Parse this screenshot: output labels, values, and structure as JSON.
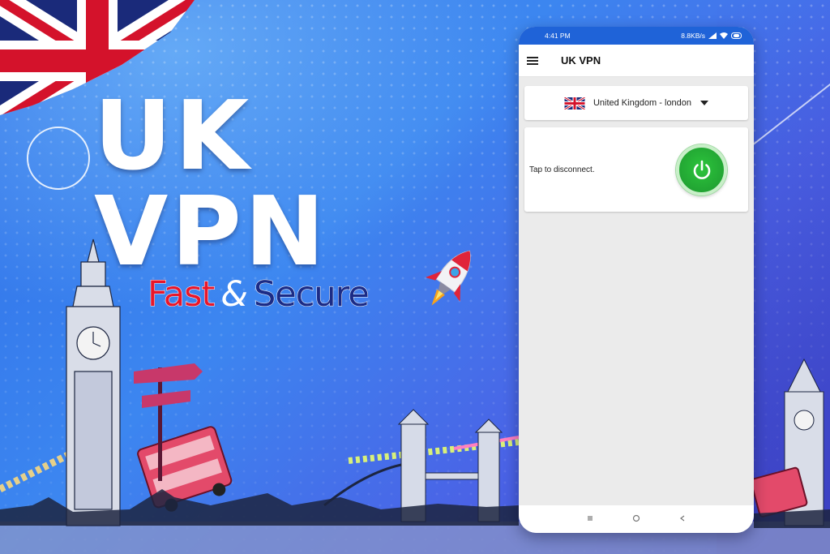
{
  "banner": {
    "headline": "UK VPN",
    "tagline_fast": "Fast",
    "tagline_amp": "&",
    "tagline_secure": "Secure"
  },
  "phone": {
    "status_bar": {
      "time": "4:41 PM",
      "speed": "8.8KB/s"
    },
    "app_bar": {
      "title": "UK VPN",
      "menu_icon": "hamburger-menu-icon"
    },
    "server": {
      "label": "United Kingdom - london",
      "flag_icon": "uk-flag-icon"
    },
    "connection": {
      "status_text": "Tap to disconnect.",
      "power_icon": "power-icon"
    },
    "nav": {
      "recents_icon": "recents-icon",
      "home_icon": "home-icon",
      "back_icon": "back-icon"
    }
  },
  "colors": {
    "background": "#3c86f0",
    "status_bar": "#1f63d8",
    "power_button": "#22a533",
    "tagline_red": "#e8162a",
    "tagline_navy": "#1b2b86"
  }
}
